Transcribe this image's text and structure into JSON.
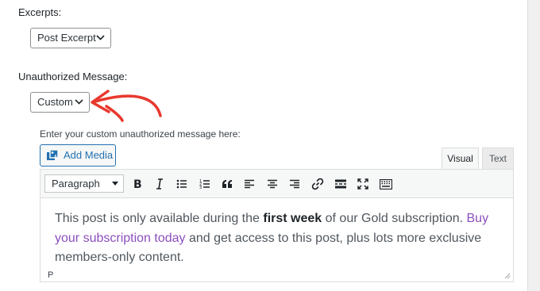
{
  "excerpts": {
    "label": "Excerpts:",
    "selected": "Post Excerpt"
  },
  "unauthorized": {
    "label": "Unauthorized Message:",
    "selected": "Custom"
  },
  "annotation": {
    "arrow_color": "#e8392e"
  },
  "editor": {
    "hint": "Enter your custom unauthorized message here:",
    "add_media_label": "Add Media",
    "tabs": {
      "visual": "Visual",
      "text": "Text"
    },
    "format_selected": "Paragraph",
    "toolbar_icons": [
      "bold-icon",
      "italic-icon",
      "bullet-list-icon",
      "numbered-list-icon",
      "blockquote-icon",
      "align-left-icon",
      "align-center-icon",
      "align-right-icon",
      "link-icon",
      "read-more-icon",
      "fullscreen-icon",
      "toolbar-toggle-icon"
    ],
    "content": {
      "part1": "This post is only available during the ",
      "bold": "first week",
      "part2": " of our Gold subscription. ",
      "link": "Buy your subscription today",
      "part3": " and get access to this post, plus lots more exclusive members-only content."
    },
    "path": "P",
    "link_color": "#8c4fbd"
  }
}
